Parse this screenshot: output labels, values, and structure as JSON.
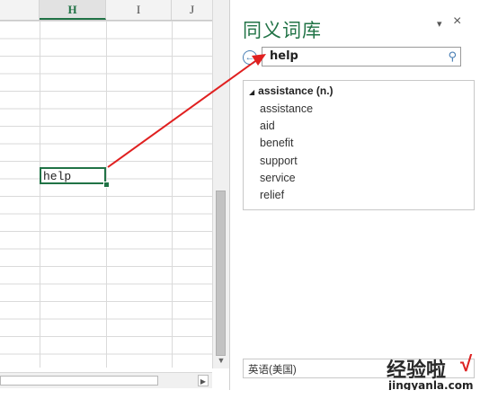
{
  "sheet": {
    "columns": [
      "H",
      "I",
      "J"
    ],
    "active_cell_value": "help"
  },
  "thesaurus": {
    "title": "同义词库",
    "menu_glyph": "▾",
    "close_glyph": "×",
    "back_glyph": "←",
    "search_value": "help",
    "search_icon": "⚲",
    "group_heading": "assistance (n.)",
    "synonyms": [
      "assistance",
      "aid",
      "benefit",
      "support",
      "service",
      "relief"
    ],
    "language": "英语(美国)"
  },
  "watermark": {
    "logo_text": "经验啦",
    "check": "√",
    "url": "jingyanla.com"
  },
  "colors": {
    "accent_green": "#217346",
    "arrow_red": "#e02020",
    "link_blue": "#4a7fb5"
  }
}
